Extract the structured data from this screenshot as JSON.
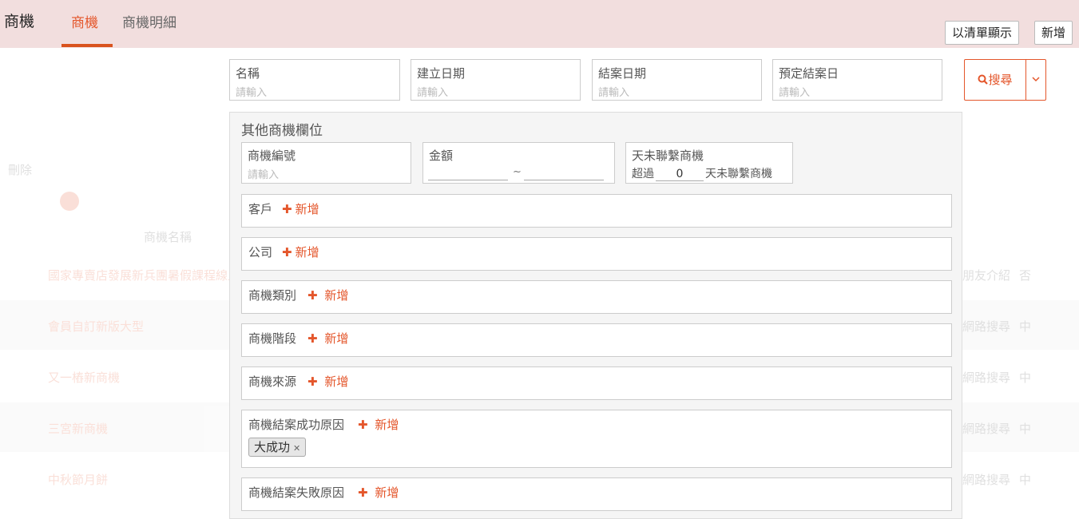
{
  "header": {
    "title": "商機",
    "tabs": [
      {
        "label": "商機",
        "active": true
      },
      {
        "label": "商機明細",
        "active": false
      }
    ],
    "list_view_button": "以清單顯示",
    "add_button": "新增"
  },
  "filters": [
    {
      "label": "名稱",
      "placeholder": "請輸入"
    },
    {
      "label": "建立日期",
      "placeholder": "請輸入"
    },
    {
      "label": "結案日期",
      "placeholder": "請輸入"
    },
    {
      "label": "預定結案日",
      "placeholder": "請輸入"
    }
  ],
  "search": {
    "label": "搜尋",
    "icon": "search-icon",
    "dropdown_icon": "chevron-down-icon"
  },
  "panel": {
    "title": "其他商機欄位",
    "opportunity_number": {
      "label": "商機編號",
      "placeholder": "請輸入"
    },
    "amount": {
      "label": "金額",
      "separator": "~"
    },
    "no_contact": {
      "label": "天未聯繫商機",
      "prefix": "超過",
      "value": "0",
      "suffix": "天未聯繫商機"
    },
    "add_label": "新增",
    "tag_fields": [
      {
        "label": "客戶"
      },
      {
        "label": "公司"
      },
      {
        "label": "商機類別"
      },
      {
        "label": "商機階段"
      },
      {
        "label": "商機來源"
      },
      {
        "label": "商機結案成功原因",
        "tags": [
          "大成功"
        ]
      },
      {
        "label": "商機結案失敗原因"
      }
    ]
  },
  "background_table": {
    "delete_label": "刪除",
    "column_header": "商機名稱",
    "rows": [
      {
        "name": "國家專賣店發展新兵團暑假課程線上說明會",
        "source": "朋友介紹",
        "status": "否"
      },
      {
        "name": "會員自訂新版大型",
        "source": "網路搜尋",
        "status": "中"
      },
      {
        "name": "又一樁新商機",
        "source": "網路搜尋",
        "status": "中"
      },
      {
        "name": "三宮新商機",
        "source": "網路搜尋",
        "status": "中"
      },
      {
        "name": "中秋節月餅",
        "source": "網路搜尋",
        "status": "中"
      }
    ]
  },
  "colors": {
    "accent": "#e4562b",
    "header_bg": "#f2dede"
  }
}
